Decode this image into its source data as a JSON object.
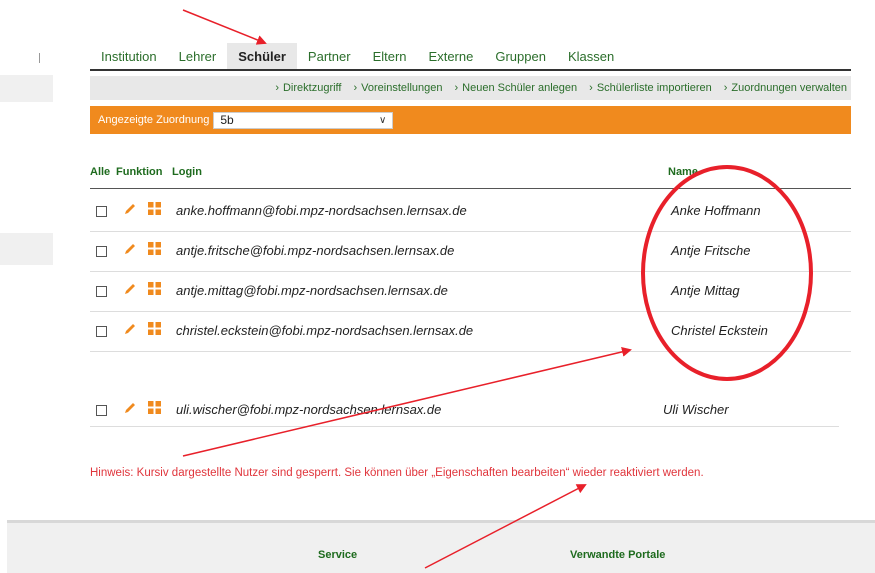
{
  "tabs": {
    "items": [
      {
        "label": "Institution"
      },
      {
        "label": "Lehrer"
      },
      {
        "label": "Schüler"
      },
      {
        "label": "Partner"
      },
      {
        "label": "Eltern"
      },
      {
        "label": "Externe"
      },
      {
        "label": "Gruppen"
      },
      {
        "label": "Klassen"
      }
    ],
    "active": "Schüler"
  },
  "subnav": {
    "items": [
      {
        "label": "Direktzugriff"
      },
      {
        "label": "Voreinstellungen"
      },
      {
        "label": "Neuen Schüler anlegen"
      },
      {
        "label": "Schülerliste importieren"
      },
      {
        "label": "Zuordnungen verwalten"
      }
    ]
  },
  "filter": {
    "label": "Angezeigte Zuordnung",
    "selected": "5b"
  },
  "table": {
    "headers": {
      "all": "Alle",
      "function": "Funktion",
      "login": "Login",
      "name": "Name"
    },
    "rows": [
      {
        "login": "anke.hoffmann@fobi.mpz-nordsachsen.lernsax.de",
        "name": "Anke Hoffmann"
      },
      {
        "login": "antje.fritsche@fobi.mpz-nordsachsen.lernsax.de",
        "name": "Antje Fritsche"
      },
      {
        "login": "antje.mittag@fobi.mpz-nordsachsen.lernsax.de",
        "name": "Antje Mittag"
      },
      {
        "login": "christel.eckstein@fobi.mpz-nordsachsen.lernsax.de",
        "name": "Christel Eckstein"
      }
    ],
    "partial_row": {
      "login": "uli.wischer@fobi.mpz-nordsachsen.lernsax.de",
      "name": "Uli Wischer"
    }
  },
  "hint": "Hinweis: Kursiv dargestellte Nutzer sind gesperrt. Sie können über „Eigenschaften bearbeiten“ wieder reaktiviert werden.",
  "footer": {
    "service": "Service",
    "related": "Verwandte Portale"
  },
  "colors": {
    "accent_orange": "#f08a1e",
    "link_green": "#2b6e2b",
    "annotation_red": "#e8202a",
    "hint_red": "#e0353c"
  }
}
